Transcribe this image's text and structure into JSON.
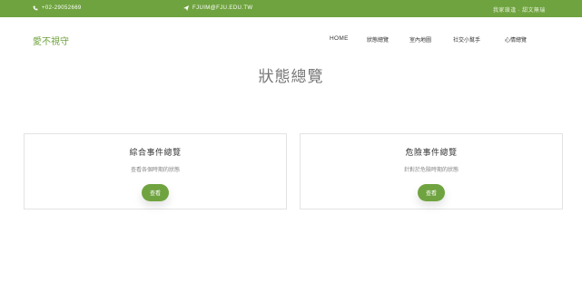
{
  "topbar": {
    "phone": "+02-29052669",
    "email": "FJUIM@FJU.EDU.TW",
    "right_links": "我家瑣逢 · 甜文無瑞",
    "color": "#6fa33f"
  },
  "nav": {
    "brand": "愛不視守",
    "items": [
      "HOME",
      "狀態總覽",
      "室內地圖",
      "社交小幫手",
      "心情總覽"
    ]
  },
  "page_title": "狀態總覽",
  "cards": [
    {
      "title": "綜合事件總覽",
      "desc": "查看各個時期的狀態",
      "button": "查看"
    },
    {
      "title": "危險事件總覽",
      "desc": "針對於危險時期的狀態",
      "button": "查看"
    }
  ]
}
